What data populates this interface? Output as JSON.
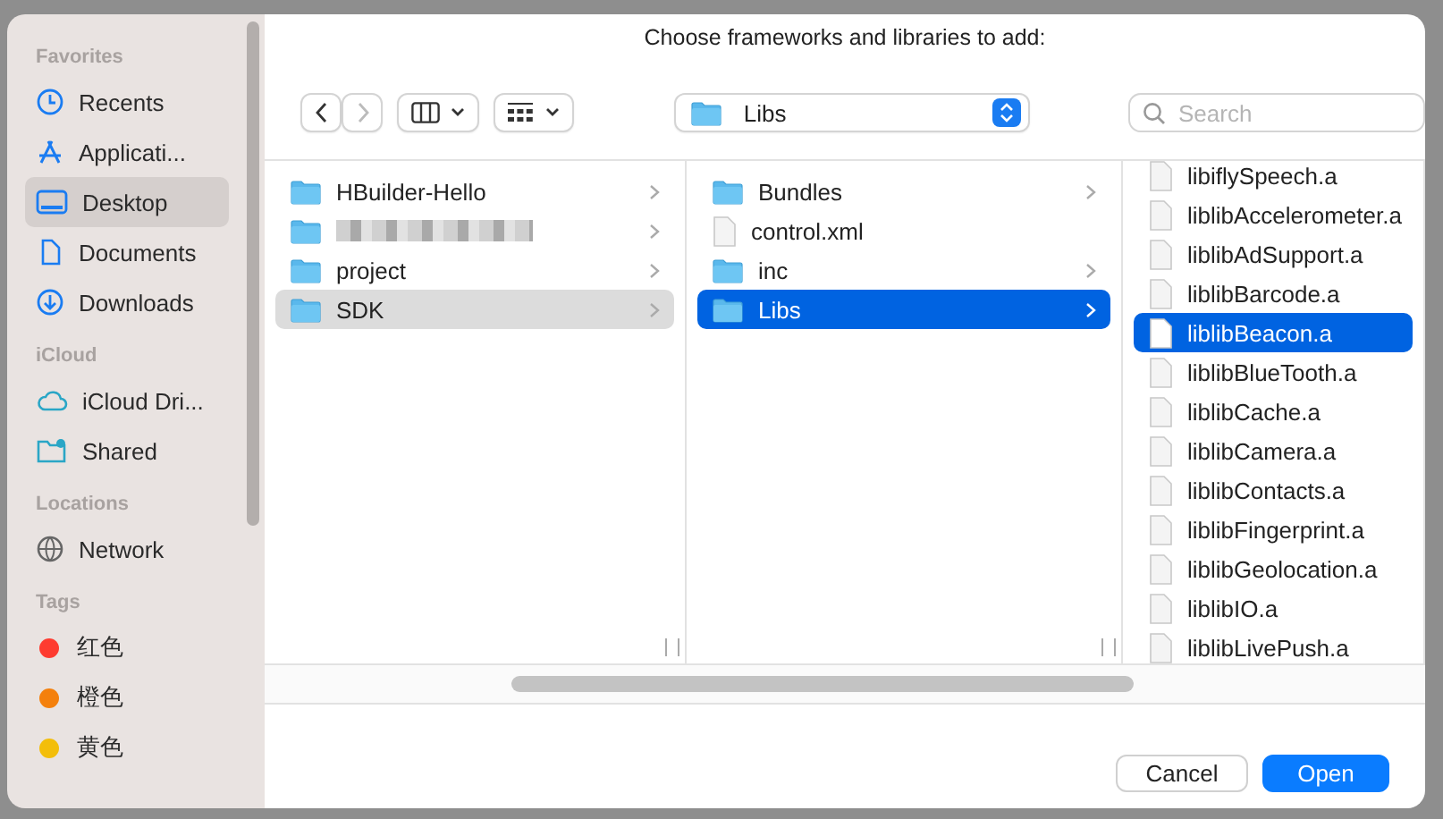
{
  "sidebar": {
    "sections": [
      {
        "heading": "Favorites",
        "items": [
          {
            "label": "Recents",
            "selected": false
          },
          {
            "label": "Applicati...",
            "selected": false
          },
          {
            "label": "Desktop",
            "selected": true
          },
          {
            "label": "Documents",
            "selected": false
          },
          {
            "label": "Downloads",
            "selected": false
          }
        ]
      },
      {
        "heading": "iCloud",
        "items": [
          {
            "label": "iCloud Dri...",
            "selected": false
          },
          {
            "label": "Shared",
            "selected": false
          }
        ]
      },
      {
        "heading": "Locations",
        "items": [
          {
            "label": "Network",
            "selected": false
          }
        ]
      },
      {
        "heading": "Tags",
        "items": [
          {
            "label": "红色",
            "color": "#fe3b30",
            "selected": false
          },
          {
            "label": "橙色",
            "color": "#f4800c",
            "selected": false
          },
          {
            "label": "黄色",
            "color": "#f3be0b",
            "selected": false
          }
        ]
      }
    ]
  },
  "title": "Choose frameworks and libraries to add:",
  "location": {
    "label": "Libs"
  },
  "search": {
    "placeholder": "Search"
  },
  "columns": [
    {
      "active": false,
      "rows": [
        {
          "kind": "folder",
          "name": "HBuilder-Hello",
          "selected": false
        },
        {
          "kind": "redacted",
          "selected": false
        },
        {
          "kind": "folder",
          "name": "project",
          "selected": false
        },
        {
          "kind": "folder",
          "name": "SDK",
          "selected": true
        }
      ]
    },
    {
      "active": true,
      "rows": [
        {
          "kind": "folder",
          "name": "Bundles",
          "selected": false
        },
        {
          "kind": "file",
          "name": "control.xml",
          "selected": false
        },
        {
          "kind": "folder",
          "name": "inc",
          "selected": false
        },
        {
          "kind": "folder",
          "name": "Libs",
          "selected": true
        }
      ]
    },
    {
      "active": true,
      "rows": [
        {
          "kind": "file",
          "name": "libiflySpeech.a",
          "selected": false
        },
        {
          "kind": "file",
          "name": "liblibAccelerometer.a",
          "selected": false
        },
        {
          "kind": "file",
          "name": "liblibAdSupport.a",
          "selected": false
        },
        {
          "kind": "file",
          "name": "liblibBarcode.a",
          "selected": false
        },
        {
          "kind": "file",
          "name": "liblibBeacon.a",
          "selected": true
        },
        {
          "kind": "file",
          "name": "liblibBlueTooth.a",
          "selected": false
        },
        {
          "kind": "file",
          "name": "liblibCache.a",
          "selected": false
        },
        {
          "kind": "file",
          "name": "liblibCamera.a",
          "selected": false
        },
        {
          "kind": "file",
          "name": "liblibContacts.a",
          "selected": false
        },
        {
          "kind": "file",
          "name": "liblibFingerprint.a",
          "selected": false
        },
        {
          "kind": "file",
          "name": "liblibGeolocation.a",
          "selected": false
        },
        {
          "kind": "file",
          "name": "liblibIO.a",
          "selected": false
        },
        {
          "kind": "file",
          "name": "liblibLivePush.a",
          "selected": false
        }
      ]
    }
  ],
  "buttons": [
    {
      "label": "Cancel",
      "kind": "secondary"
    },
    {
      "label": "Open",
      "kind": "primary"
    }
  ]
}
